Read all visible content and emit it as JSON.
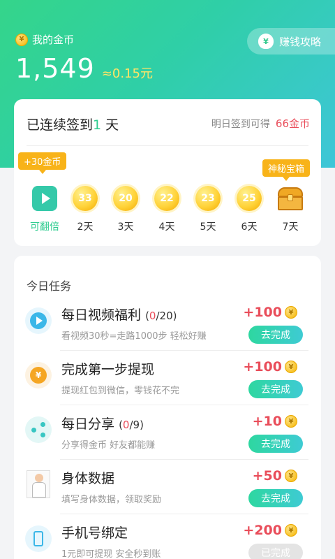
{
  "header": {
    "my_coins_label": "我的金币",
    "balance": "1,549",
    "approx_yuan": "≈0.15元",
    "guide_button": "赚钱攻略"
  },
  "signin": {
    "title_prefix": "已连续签到",
    "days": "1",
    "title_suffix": "天",
    "tomorrow_label": "明日签到可得",
    "tomorrow_reward": "66金币",
    "bonus_badge": "+30金币",
    "mystery_badge": "神秘宝箱",
    "days_list": [
      {
        "value": "",
        "label": "可翻倍"
      },
      {
        "value": "33",
        "label": "2天"
      },
      {
        "value": "20",
        "label": "3天"
      },
      {
        "value": "22",
        "label": "4天"
      },
      {
        "value": "23",
        "label": "5天"
      },
      {
        "value": "25",
        "label": "6天"
      },
      {
        "value": "",
        "label": "7天"
      }
    ]
  },
  "tasks": {
    "title": "今日任务",
    "items": [
      {
        "name": "每日视频福利",
        "progress_open": "(",
        "progress_done": "0",
        "progress_total": "/20)",
        "desc": "看视频30秒=走路1000步 轻松好赚",
        "reward": "+100",
        "button": "去完成",
        "icon": "video-icon"
      },
      {
        "name": "完成第一步提现",
        "progress_open": "",
        "progress_done": "",
        "progress_total": "",
        "desc": "提现红包到微信，零钱花不完",
        "reward": "+100",
        "button": "去完成",
        "icon": "yen-coin-icon"
      },
      {
        "name": "每日分享",
        "progress_open": "(",
        "progress_done": "0",
        "progress_total": "/9)",
        "desc": "分享得金币 好友都能赚",
        "reward": "+10",
        "button": "去完成",
        "icon": "share-icon"
      },
      {
        "name": "身体数据",
        "progress_open": "",
        "progress_done": "",
        "progress_total": "",
        "desc": "填写身体数据，领取奖励",
        "reward": "+50",
        "button": "去完成",
        "icon": "doctor-avatar-icon"
      },
      {
        "name": "手机号绑定",
        "progress_open": "",
        "progress_done": "",
        "progress_total": "",
        "desc": "1元即可提现 安全秒到账",
        "reward": "+200",
        "button": "已完成",
        "icon": "phone-icon"
      }
    ]
  },
  "colors": {
    "accent_green": "#2ecc8f",
    "reward_red": "#e94d5a",
    "badge_orange": "#f8b319"
  }
}
